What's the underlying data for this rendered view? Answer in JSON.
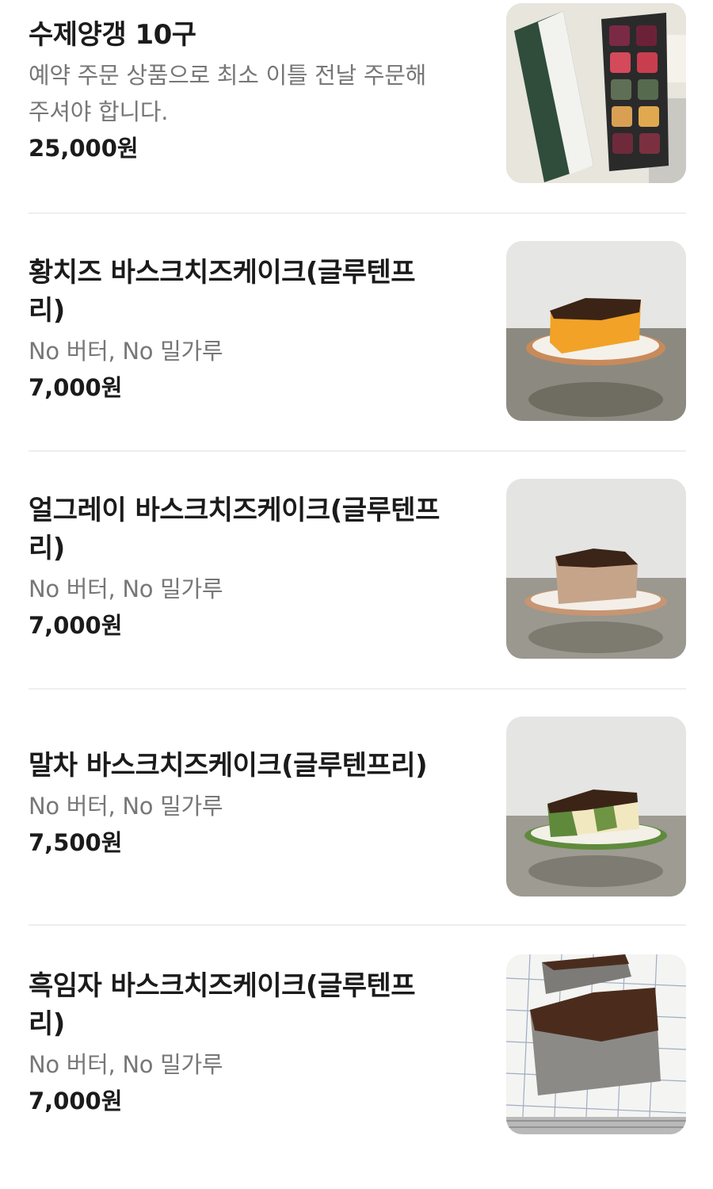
{
  "menu": {
    "items": [
      {
        "name": "수제양갱 10구",
        "description_lines": [
          "예약 주문 상품으로 최소 이틀 전날 주문해",
          "주셔야 합니다."
        ],
        "price": "25,000원",
        "image_icon": "yanggaeng-gift-box-photo"
      },
      {
        "name_lines": [
          "황치즈 바스크치즈케이크(글루텐프",
          "리)"
        ],
        "description": "No 버터, No 밀가루",
        "price": "7,000원",
        "image_icon": "yellow-cheese-cake-photo"
      },
      {
        "name_lines": [
          "얼그레이 바스크치즈케이크(글루텐프",
          "리)"
        ],
        "description": "No 버터, No 밀가루",
        "price": "7,000원",
        "image_icon": "earl-grey-cheesecake-photo"
      },
      {
        "name": "말차 바스크치즈케이크(글루텐프리)",
        "description": "No 버터, No 밀가루",
        "price": "7,500원",
        "image_icon": "matcha-cheesecake-photo"
      },
      {
        "name_lines": [
          "흑임자 바스크치즈케이크(글루텐프",
          "리)"
        ],
        "description": "No 버터, No 밀가루",
        "price": "7,000원",
        "image_icon": "black-sesame-cheesecake-photo"
      }
    ]
  },
  "colors": {
    "text_primary": "#1b1b1b",
    "text_secondary": "#777777",
    "divider": "#eeeeee",
    "box_green": "#2f4d3a",
    "cake_yellow": "#f2a227",
    "cake_crust": "#3b2416",
    "matcha_green": "#5f8a3c"
  }
}
